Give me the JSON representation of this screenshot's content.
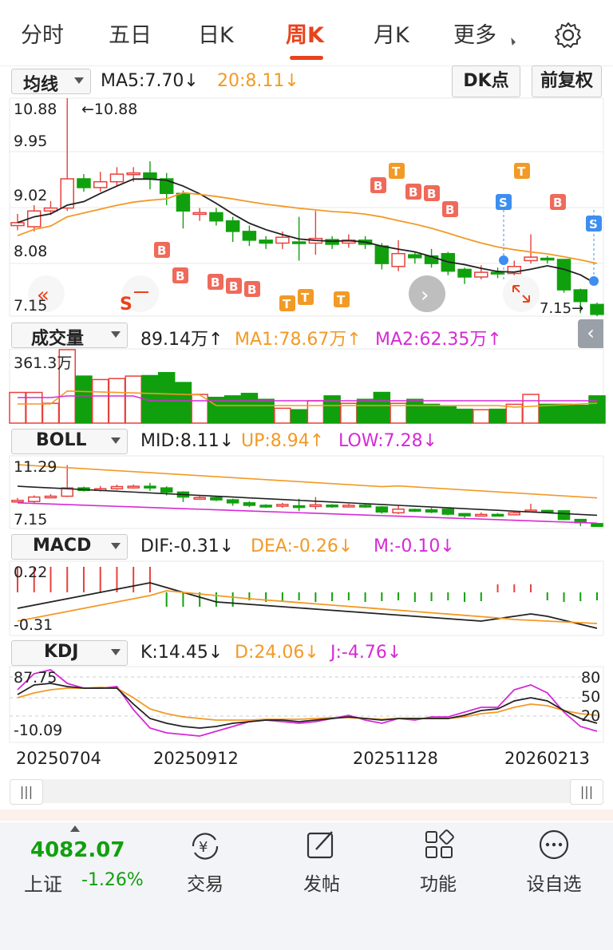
{
  "tabs": {
    "items": [
      "分时",
      "五日",
      "日K",
      "周K",
      "月K",
      "更多"
    ],
    "active": "周K"
  },
  "main": {
    "selector": "均线",
    "ma5": "MA5:7.70↓",
    "ma20": "20:8.11↓",
    "dk_button": "DK点",
    "fq_button": "前复权",
    "y_labels": [
      "10.88",
      "9.95",
      "9.02",
      "8.08",
      "7.15"
    ],
    "max_mark": "←10.88",
    "min_mark": "7.15→",
    "signal_b": "B",
    "signal_s": "S",
    "signal_t": "T",
    "nav_prev": "«",
    "nav_s": "S",
    "nav_next": "›",
    "nav_left": "‹"
  },
  "volume": {
    "selector": "成交量",
    "value": "89.14万↑",
    "ma1": "MA1:78.67万↑",
    "ma2": "MA2:62.35万↑",
    "max_label": "361.3万"
  },
  "boll": {
    "selector": "BOLL",
    "mid": "MID:8.11↓",
    "up": "UP:8.94↑",
    "low": "LOW:7.28↓",
    "y_top": "11.29",
    "y_bottom": "7.15"
  },
  "macd": {
    "selector": "MACD",
    "dif": "DIF:-0.31↓",
    "dea": "DEA:-0.26↓",
    "m": "M:-0.10↓",
    "y_top": "0.22",
    "y_bottom": "-0.31"
  },
  "kdj": {
    "selector": "KDJ",
    "k": "K:14.45↓",
    "d": "D:24.06↓",
    "j": "J:-4.76↓",
    "y_top": "87.75",
    "y_bottom": "-10.09",
    "right_levels": [
      "80",
      "50",
      "20"
    ]
  },
  "dates": [
    "20250704",
    "20250912",
    "20251128",
    "20260213"
  ],
  "scroll": {
    "left": "|||",
    "right": "|||"
  },
  "footer": {
    "index_value": "4082.07",
    "index_name": "上证",
    "index_change": "-1.26%",
    "items": [
      "交易",
      "发帖",
      "功能",
      "设自选"
    ]
  },
  "colors": {
    "up": "#e8413c",
    "down": "#11a00d",
    "accent": "#e8431c",
    "orange": "#f29a26",
    "magenta": "#d62ad6",
    "blue": "#3d8ef0"
  }
}
